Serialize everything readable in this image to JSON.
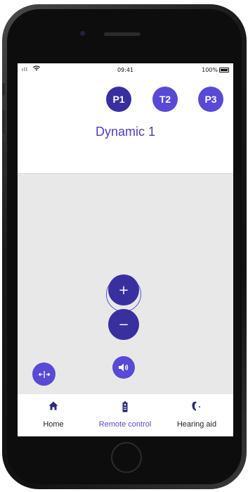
{
  "status_bar": {
    "time": "09:41",
    "battery": "100%",
    "signal": "ıll"
  },
  "programs": [
    {
      "label": "P1",
      "active": true
    },
    {
      "label": "T2",
      "active": false
    },
    {
      "label": "P3",
      "active": false
    }
  ],
  "program_name": "Dynamic 1",
  "volume": {
    "value": "0",
    "increase_label": "+",
    "decrease_label": "−"
  },
  "tabs": [
    {
      "label": "Home",
      "icon": "home-icon",
      "active": false
    },
    {
      "label": "Remote control",
      "icon": "remote-icon",
      "active": true
    },
    {
      "label": "Hearing aid",
      "icon": "hearing-aid-icon",
      "active": false
    }
  ],
  "colors": {
    "accent": "#5849d6",
    "accent_dark": "#3a2f9f",
    "panel": "#e8e8e8"
  }
}
